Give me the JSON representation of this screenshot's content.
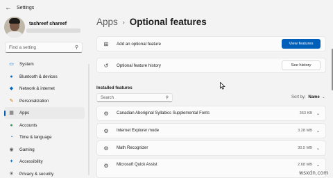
{
  "window": {
    "title": "Settings",
    "back_icon": "back-arrow-icon"
  },
  "user": {
    "name": "tashreef shareef"
  },
  "search": {
    "placeholder": "Find a setting"
  },
  "nav": {
    "items": [
      {
        "label": "System",
        "icon": "monitor-icon",
        "color": "#0067c0",
        "active": false
      },
      {
        "label": "Bluetooth & devices",
        "icon": "bluetooth-icon",
        "color": "#0067c0",
        "active": false
      },
      {
        "label": "Network & internet",
        "icon": "wifi-icon",
        "color": "#0067c0",
        "active": false
      },
      {
        "label": "Personalization",
        "icon": "brush-icon",
        "color": "#d86e00",
        "active": false
      },
      {
        "label": "Apps",
        "icon": "apps-icon",
        "color": "#5a5a5a",
        "active": true
      },
      {
        "label": "Accounts",
        "icon": "person-icon",
        "color": "#2d9e55",
        "active": false
      },
      {
        "label": "Time & language",
        "icon": "clock-globe-icon",
        "color": "#0067c0",
        "active": false
      },
      {
        "label": "Gaming",
        "icon": "gamepad-icon",
        "color": "#5a5a5a",
        "active": false
      },
      {
        "label": "Accessibility",
        "icon": "accessibility-icon",
        "color": "#0067c0",
        "active": false
      },
      {
        "label": "Privacy & security",
        "icon": "shield-icon",
        "color": "#5a5a5a",
        "active": false
      }
    ]
  },
  "breadcrumb": {
    "parent": "Apps",
    "separator": "›",
    "current": "Optional features"
  },
  "add_feature": {
    "label": "Add an optional feature",
    "button": "View features",
    "icon": "add-feature-icon"
  },
  "history": {
    "label": "Optional feature history",
    "button": "See history",
    "icon": "history-icon"
  },
  "installed": {
    "title": "Installed features",
    "search_placeholder": "Search",
    "sort_label": "Sort by:",
    "sort_value": "Name",
    "features": [
      {
        "name": "Canadian Aboriginal Syllabics Supplemental Fonts",
        "size": "363 KB"
      },
      {
        "name": "Internet Explorer mode",
        "size": "3.28 MB"
      },
      {
        "name": "Math Recognizer",
        "size": "30.5 MB"
      },
      {
        "name": "Microsoft Quick Assist",
        "size": "2.68 MB"
      }
    ]
  },
  "watermark": "wsxdn.com",
  "colors": {
    "accent": "#005fb8",
    "background": "#f3f3f3",
    "card": "#fbfbfb"
  }
}
